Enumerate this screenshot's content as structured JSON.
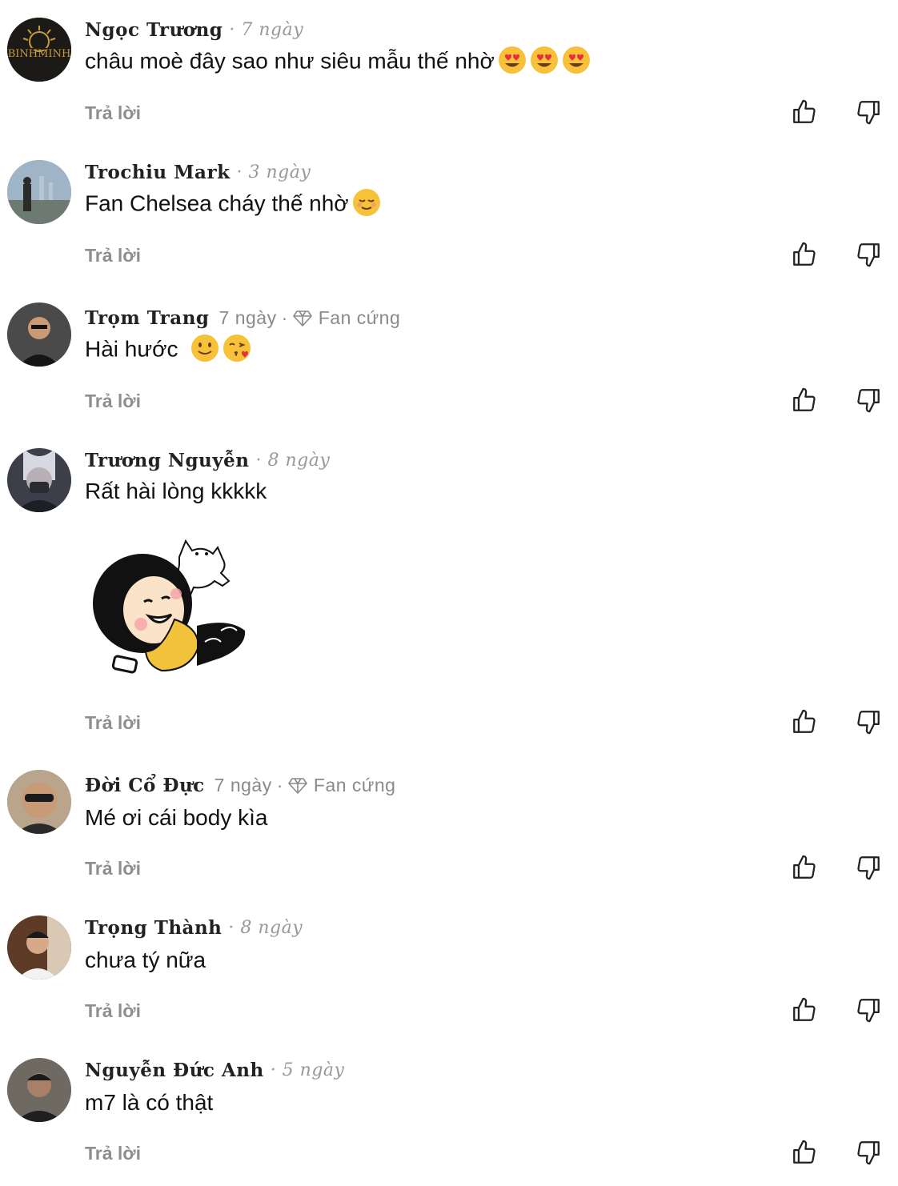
{
  "reply_label": "Trả lời",
  "comments": [
    {
      "name": "Ngọc Trương",
      "name_tail": "· 7 ngày",
      "time": "",
      "badge": "",
      "text": "châu moè đây sao như siêu mẫu thế nhờ",
      "emojis": [
        "heart-eyes",
        "heart-eyes",
        "heart-eyes"
      ],
      "avatar_label": "BINHMINH"
    },
    {
      "name": "Trochiu Mark",
      "name_tail": "· 3 ngày",
      "time": "",
      "badge": "",
      "text": "Fan Chelsea cháy thế nhờ",
      "emojis": [
        "relieved"
      ],
      "avatar_label": ""
    },
    {
      "name": "Trọm Trang",
      "name_tail": "",
      "time": "7 ngày",
      "badge": "Fan cứng",
      "text": "Hài hước",
      "emojis": [
        "slight-smile",
        "kissing-heart"
      ],
      "avatar_label": ""
    },
    {
      "name": "Trương Nguyễn",
      "name_tail": "· 8 ngày",
      "time": "",
      "badge": "",
      "text": "Rất hài lòng kkkkk",
      "emojis": [],
      "avatar_label": ""
    },
    {
      "name": "Đời Cổ Đực",
      "name_tail": "",
      "time": "7 ngày",
      "badge": "Fan cứng",
      "text": "Mé ơi cái body kìa",
      "emojis": [],
      "avatar_label": ""
    },
    {
      "name": "Trọng Thành",
      "name_tail": "· 8 ngày",
      "time": "",
      "badge": "",
      "text": "chưa tý nữa",
      "emojis": [],
      "avatar_label": ""
    },
    {
      "name": "Nguyễn Đức Anh",
      "name_tail": "· 5 ngày",
      "time": "",
      "badge": "",
      "text": "m7 là có thật",
      "emojis": [],
      "avatar_label": ""
    }
  ],
  "colors": {
    "muted": "#8e8e8e",
    "text": "#111111",
    "avatar_dark": "#2b2b2b",
    "sticker_yellow": "#f2c23a"
  }
}
